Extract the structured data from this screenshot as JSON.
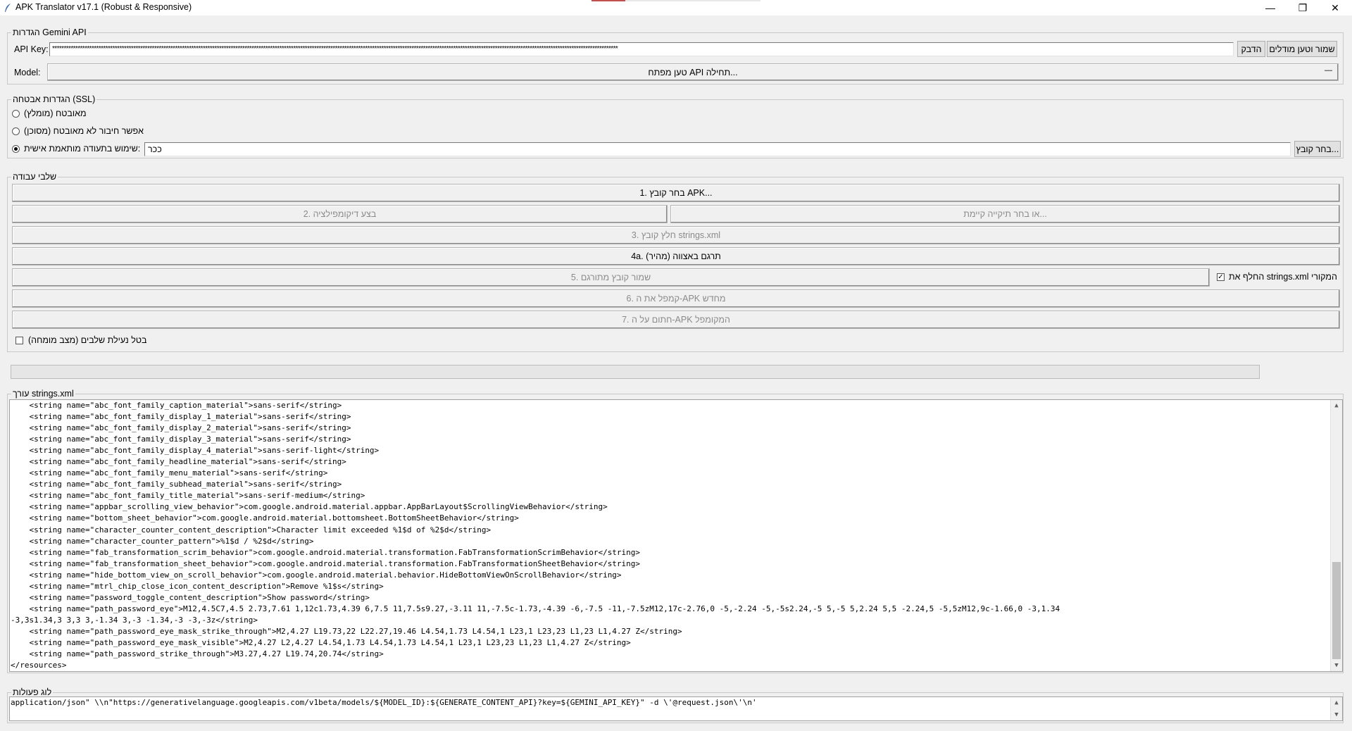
{
  "window": {
    "title": "APK Translator v17.1 (Robust & Responsive)",
    "minimize_glyph": "—",
    "restore_glyph": "❐",
    "close_glyph": "✕"
  },
  "gemini": {
    "group_label": "הגדרות Gemini API",
    "api_key_label": "API Key:",
    "api_key_value": "****************************************************************************************************************************************************************************************************************************************************",
    "paste_button": "הדבק",
    "save_load_button": "שמור וטען מודלים",
    "model_label": "Model:",
    "model_value": "טען מפתח API תחילה...",
    "model_dropdown_glyph": "—"
  },
  "ssl": {
    "group_label": "הגדרות אבטחה (SSL)",
    "options": [
      {
        "label": "מאובטח (מומלץ)",
        "selected": false
      },
      {
        "label": "אפשר חיבור לא מאובטח (מסוכן)",
        "selected": false
      },
      {
        "label": "שימוש בתעודה מותאמת אישית:",
        "selected": true
      }
    ],
    "cert_path": "ככר",
    "choose_file_button": "בחר קובץ..."
  },
  "steps": {
    "group_label": "שלבי עבודה",
    "step1": "1. בחר קובץ APK...",
    "step2": "2. בצע דיקומפילציה",
    "step2_alt": "או בחר תיקייה קיימת...",
    "step3": "3. חלץ קובץ strings.xml",
    "step4a": "4a. תרגם באצווה (מהיר)",
    "step5": "5. שמור קובץ מתורגם",
    "replace_label": "החלף את strings.xml המקורי",
    "replace_checked": true,
    "step6": "6. קמפל את ה-APK מחדש",
    "step7": "7. חתום על ה-APK המקומפל",
    "unlock_label": "בטל נעילת שלבים (מצב מומחה)",
    "unlock_checked": false
  },
  "progress": {
    "value": 0
  },
  "editor": {
    "group_label": "עורך strings.xml",
    "lines": [
      "    <string name=\"abc_font_family_caption_material\">sans-serif</string>",
      "    <string name=\"abc_font_family_display_1_material\">sans-serif</string>",
      "    <string name=\"abc_font_family_display_2_material\">sans-serif</string>",
      "    <string name=\"abc_font_family_display_3_material\">sans-serif</string>",
      "    <string name=\"abc_font_family_display_4_material\">sans-serif-light</string>",
      "    <string name=\"abc_font_family_headline_material\">sans-serif</string>",
      "    <string name=\"abc_font_family_menu_material\">sans-serif</string>",
      "    <string name=\"abc_font_family_subhead_material\">sans-serif</string>",
      "    <string name=\"abc_font_family_title_material\">sans-serif-medium</string>",
      "    <string name=\"appbar_scrolling_view_behavior\">com.google.android.material.appbar.AppBarLayout$ScrollingViewBehavior</string>",
      "    <string name=\"bottom_sheet_behavior\">com.google.android.material.bottomsheet.BottomSheetBehavior</string>",
      "    <string name=\"character_counter_content_description\">Character limit exceeded %1$d of %2$d</string>",
      "    <string name=\"character_counter_pattern\">%1$d / %2$d</string>",
      "    <string name=\"fab_transformation_scrim_behavior\">com.google.android.material.transformation.FabTransformationScrimBehavior</string>",
      "    <string name=\"fab_transformation_sheet_behavior\">com.google.android.material.transformation.FabTransformationSheetBehavior</string>",
      "    <string name=\"hide_bottom_view_on_scroll_behavior\">com.google.android.material.behavior.HideBottomViewOnScrollBehavior</string>",
      "    <string name=\"mtrl_chip_close_icon_content_description\">Remove %1$s</string>",
      "    <string name=\"password_toggle_content_description\">Show password</string>",
      "    <string name=\"path_password_eye\">M12,4.5C7,4.5 2.73,7.61 1,12c1.73,4.39 6,7.5 11,7.5s9.27,-3.11 11,-7.5c-1.73,-4.39 -6,-7.5 -11,-7.5zM12,17c-2.76,0 -5,-2.24 -5,-5s2.24,-5 5,-5 5,2.24 5,5 -2.24,5 -5,5zM12,9c-1.66,0 -3,1.34",
      "-3,3s1.34,3 3,3 3,-1.34 3,-3 -1.34,-3 -3,-3z</string>",
      "    <string name=\"path_password_eye_mask_strike_through\">M2,4.27 L19.73,22 L22.27,19.46 L4.54,1.73 L4.54,1 L23,1 L23,23 L1,23 L1,4.27 Z</string>",
      "    <string name=\"path_password_eye_mask_visible\">M2,4.27 L2,4.27 L4.54,1.73 L4.54,1.73 L4.54,1 L23,1 L23,23 L1,23 L1,4.27 Z</string>",
      "    <string name=\"path_password_strike_through\">M3.27,4.27 L19.74,20.74</string>",
      "</resources>"
    ]
  },
  "log": {
    "group_label": "לוג פעולות",
    "text": "application/json\" \\\\n\"https://generativelanguage.googleapis.com/v1beta/models/${MODEL_ID}:${GENERATE_CONTENT_API}?key=${GEMINI_API_KEY}\" -d \\'@request.json\\'\\n'"
  }
}
